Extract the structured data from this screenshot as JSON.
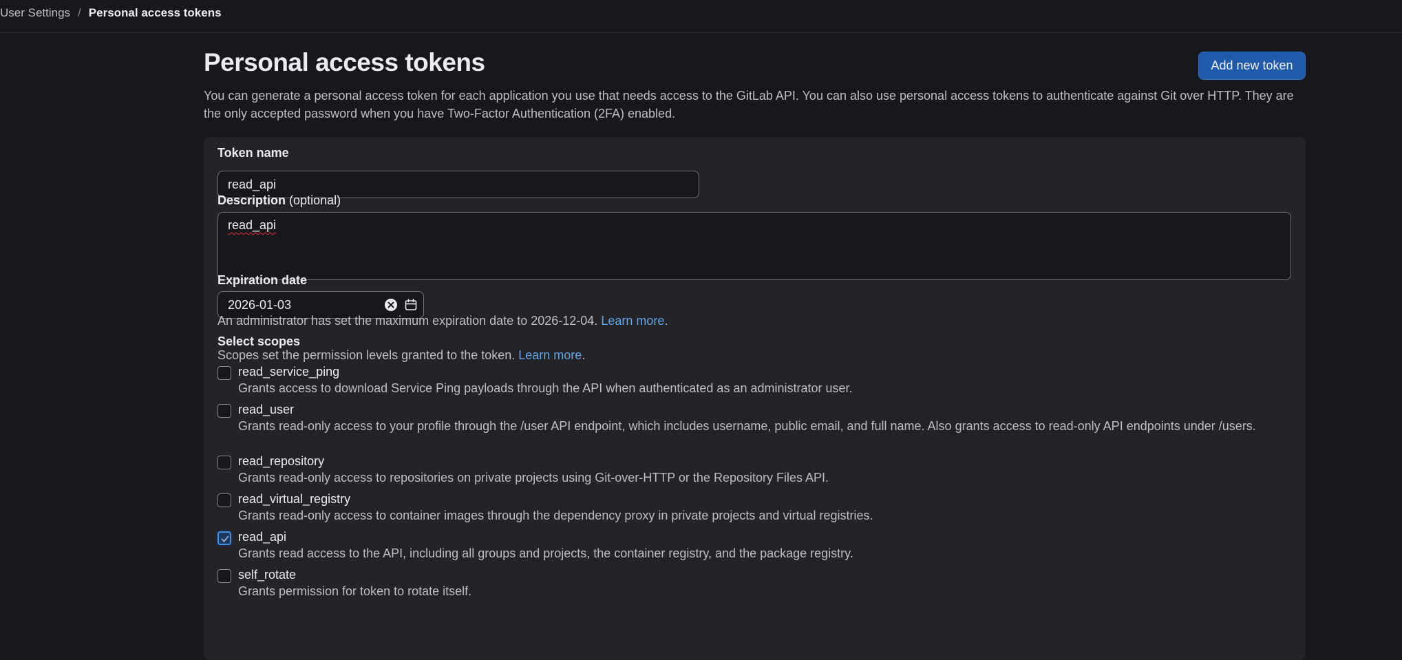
{
  "breadcrumb": {
    "parent": "User Settings",
    "separator": "/",
    "current": "Personal access tokens"
  },
  "page": {
    "title": "Personal access tokens",
    "add_button": "Add new token",
    "intro": "You can generate a personal access token for each application you use that needs access to the GitLab API. You can also use personal access tokens to authenticate against Git over HTTP. They are the only accepted password when you have Two-Factor Authentication (2FA) enabled."
  },
  "form": {
    "token_name": {
      "label": "Token name",
      "value": "read_api"
    },
    "description": {
      "label": "Description",
      "optional": "(optional)",
      "value": "read_api"
    },
    "expiration": {
      "label": "Expiration date",
      "value": "2026-01-03",
      "help": "An administrator has set the maximum expiration date to 2026-12-04.",
      "help_link": "Learn more",
      "help_suffix": "."
    },
    "scopes": {
      "label": "Select scopes",
      "help": "Scopes set the permission levels granted to the token.",
      "help_link": "Learn more",
      "help_suffix": ".",
      "items": [
        {
          "name": "read_service_ping",
          "description": "Grants access to download Service Ping payloads through the API when authenticated as an administrator user.",
          "checked": false
        },
        {
          "name": "read_user",
          "description": "Grants read-only access to your profile through the /user API endpoint, which includes username, public email, and full name. Also grants access to read-only API endpoints under /users.",
          "checked": false
        },
        {
          "name": "read_repository",
          "description": "Grants read-only access to repositories on private projects using Git-over-HTTP or the Repository Files API.",
          "checked": false
        },
        {
          "name": "read_virtual_registry",
          "description": "Grants read-only access to container images through the dependency proxy in private projects and virtual registries.",
          "checked": false
        },
        {
          "name": "read_api",
          "description": "Grants read access to the API, including all groups and projects, the container registry, and the package registry.",
          "checked": true
        },
        {
          "name": "self_rotate",
          "description": "Grants permission for token to rotate itself.",
          "checked": false
        }
      ]
    }
  },
  "icons": {
    "clear": "clear-icon",
    "calendar": "calendar-icon",
    "check": "check-icon"
  },
  "colors": {
    "background": "#18171d",
    "card": "#232328",
    "primary_button": "#1f5ba8",
    "link": "#63a6e9"
  }
}
